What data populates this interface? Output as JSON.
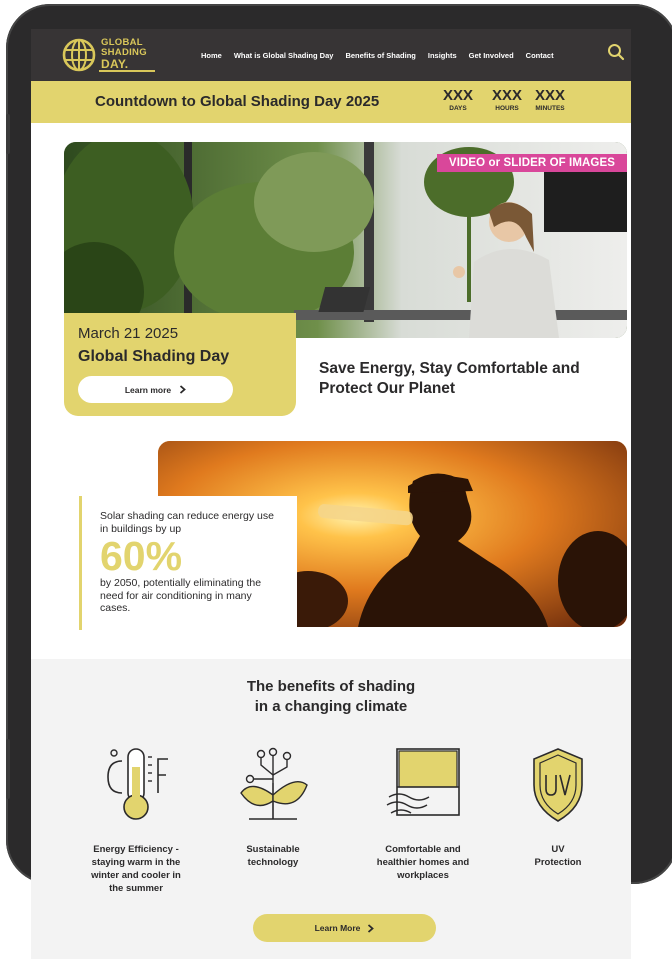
{
  "brand": {
    "logo_lines": [
      "GLOBAL",
      "SHADING",
      "DAY."
    ],
    "accent": "#e2d46e",
    "dark": "#373435",
    "pink": "#d9479a"
  },
  "nav": {
    "items": [
      "Home",
      "What is Global Shading Day",
      "Benefits of Shading",
      "Insights",
      "Get Involved",
      "Contact"
    ],
    "search_icon": "search-icon"
  },
  "countdown": {
    "title": "Countdown to Global Shading Day 2025",
    "units": [
      {
        "value": "XXX",
        "label": "DAYS"
      },
      {
        "value": "XXX",
        "label": "HOURS"
      },
      {
        "value": "XXX",
        "label": "MINUTES"
      }
    ]
  },
  "hero": {
    "media_tag": "VIDEO or SLIDER OF IMAGES",
    "date": "March 21 2025",
    "title": "Global Shading Day",
    "button_label": "Learn more",
    "tagline": "Save Energy, Stay Comfortable and Protect Our Planet"
  },
  "solar": {
    "intro": "Solar shading can reduce energy use in buildings by up",
    "value": "60%",
    "outro": "by 2050, potentially eliminating the need for air conditioning in many cases."
  },
  "benefits": {
    "title_line1": "The benefits of shading",
    "title_line2": "in a changing climate",
    "items": [
      {
        "label": "Energy Efficiency -\nstaying warm in the\nwinter and cooler in\nthe summer",
        "icon": "thermometer-icon"
      },
      {
        "label": "Sustainable\ntechnology",
        "icon": "plant-circuit-icon"
      },
      {
        "label": "Comfortable and\nhealthier homes and\nworkplaces",
        "icon": "window-blind-icon"
      },
      {
        "label": "UV\nProtection",
        "icon": "uv-shield-icon"
      }
    ],
    "button_label": "Learn More"
  }
}
